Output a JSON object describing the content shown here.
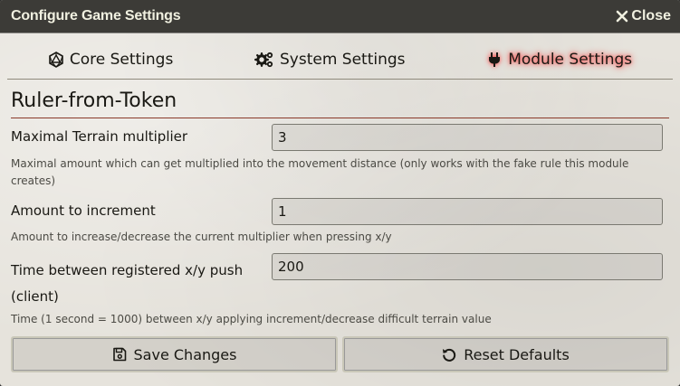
{
  "window": {
    "title": "Configure Game Settings",
    "close_label": "Close"
  },
  "tabs": [
    {
      "label": "Core Settings",
      "icon": "d20-icon",
      "active": false
    },
    {
      "label": "System Settings",
      "icon": "cogs-icon",
      "active": false
    },
    {
      "label": "Module Settings",
      "icon": "plug-icon",
      "active": true
    }
  ],
  "module": {
    "title": "Ruler-from-Token",
    "settings": [
      {
        "label": "Maximal Terrain multiplier",
        "value": "3",
        "hint": "Maximal amount which can get multiplied into the movement distance (only works with the fake rule this module creates)"
      },
      {
        "label": "Amount to increment",
        "value": "1",
        "hint": "Amount to increase/decrease the current multiplier when pressing x/y"
      },
      {
        "label": "Time between registered x/y push (client)",
        "value": "200",
        "hint": "Time (1 second = 1000) between x/y applying increment/decrease difficult terrain value"
      }
    ]
  },
  "footer": {
    "save_label": "Save Changes",
    "reset_label": "Reset Defaults"
  },
  "colors": {
    "titlebar": "#3c3b37",
    "active_tab_glow": "#ff2d2d",
    "section_rule": "#8a3a2a"
  }
}
